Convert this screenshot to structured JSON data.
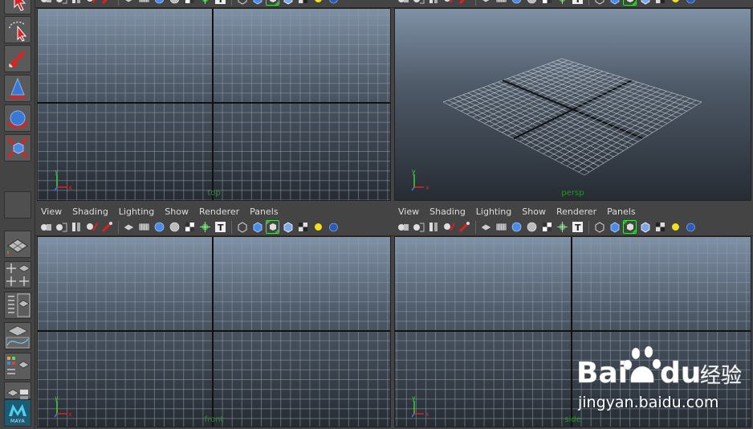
{
  "viewport_menu": [
    "View",
    "Shading",
    "Lighting",
    "Show",
    "Renderer",
    "Panels"
  ],
  "cameras": {
    "top": "top",
    "persp": "persp",
    "front": "front",
    "side": "side"
  },
  "axis": {
    "x": "x",
    "y": "y",
    "z": "z"
  },
  "maya_logo_text": "MAYA",
  "watermark": {
    "text": "jingyan.baidu.com",
    "brand": "Bai du 经验"
  },
  "colors": {
    "ui_background": "#444444",
    "viewport_top": "#7f91a6",
    "viewport_bottom": "#272c33",
    "selection_green": "#46e046",
    "camera_label": "#2f8b2f"
  }
}
